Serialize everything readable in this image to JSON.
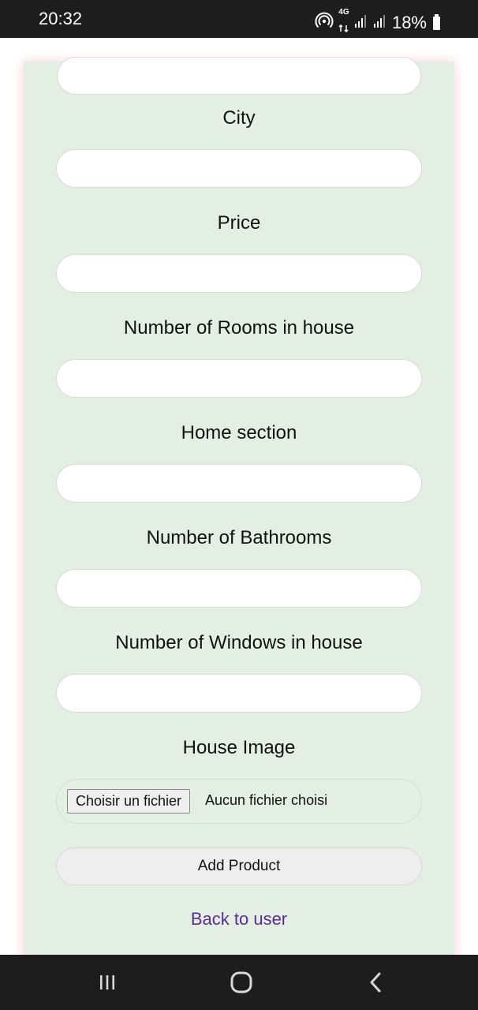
{
  "status_bar": {
    "time": "20:32",
    "network": "4G",
    "battery": "18%",
    "icons": [
      "hotspot-icon",
      "network-4g-icon",
      "signal-icon",
      "signal-icon",
      "battery-icon"
    ]
  },
  "form": {
    "fields": [
      {
        "label": "City",
        "value": "",
        "placeholder": ""
      },
      {
        "label": "Price",
        "value": "",
        "placeholder": ""
      },
      {
        "label": "Number of Rooms in house",
        "value": "",
        "placeholder": ""
      },
      {
        "label": "Home section",
        "value": "",
        "placeholder": ""
      },
      {
        "label": "Number of Bathrooms",
        "value": "",
        "placeholder": ""
      },
      {
        "label": "Number of Windows in house",
        "value": "",
        "placeholder": ""
      }
    ],
    "image": {
      "label": "House Image",
      "button_label": "Choisir un fichier",
      "status": "Aucun fichier choisi"
    },
    "submit_label": "Add Product",
    "back_link": "Back to user"
  },
  "nav_bar": {
    "icons": [
      "recent-apps-icon",
      "home-icon",
      "back-icon"
    ]
  },
  "colors": {
    "card_background": "#e4efe4",
    "link": "#5b2d8e",
    "system_bar": "#1d1d1d"
  }
}
